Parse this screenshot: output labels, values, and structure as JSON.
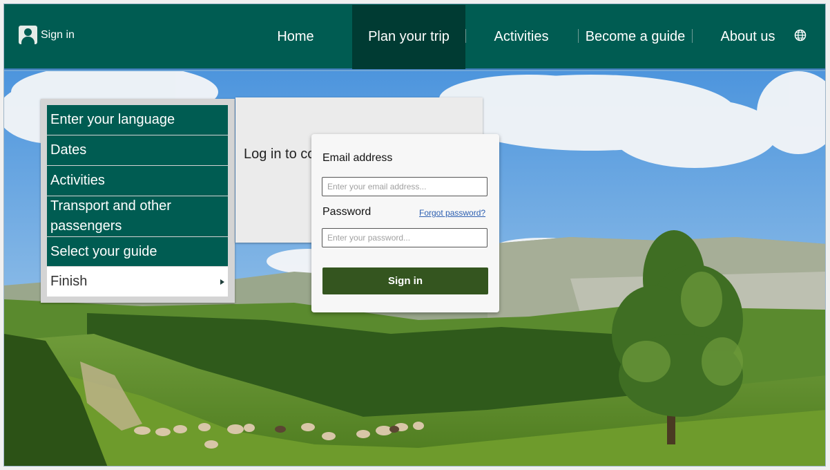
{
  "header": {
    "signin_label": "Sign in",
    "nav": [
      {
        "label": "Home",
        "active": false
      },
      {
        "label": "Plan your trip",
        "active": true
      },
      {
        "label": "Activities",
        "active": false
      },
      {
        "label": "Become a guide",
        "active": false
      },
      {
        "label": "About us",
        "active": false
      }
    ],
    "language_icon": "globe-icon",
    "user_icon": "user-icon"
  },
  "steps": [
    {
      "label": "Enter your language"
    },
    {
      "label": "Dates"
    },
    {
      "label": "Activities"
    },
    {
      "label": "Transport and other passengers"
    },
    {
      "label": "Select your guide"
    },
    {
      "label": "Finish",
      "current": true
    }
  ],
  "main": {
    "login_message": "Log in to co"
  },
  "login": {
    "email_label": "Email address",
    "email_placeholder": "Enter your email address...",
    "email_value": "",
    "password_label": "Password",
    "forgot_label": "Forgot password?",
    "password_placeholder": "Enter your password...",
    "password_value": "",
    "submit_label": "Sign in"
  },
  "colors": {
    "brand_green": "#005c52",
    "active_nav": "#003b33",
    "button_green": "#34551f",
    "link_blue": "#2a5db0"
  }
}
